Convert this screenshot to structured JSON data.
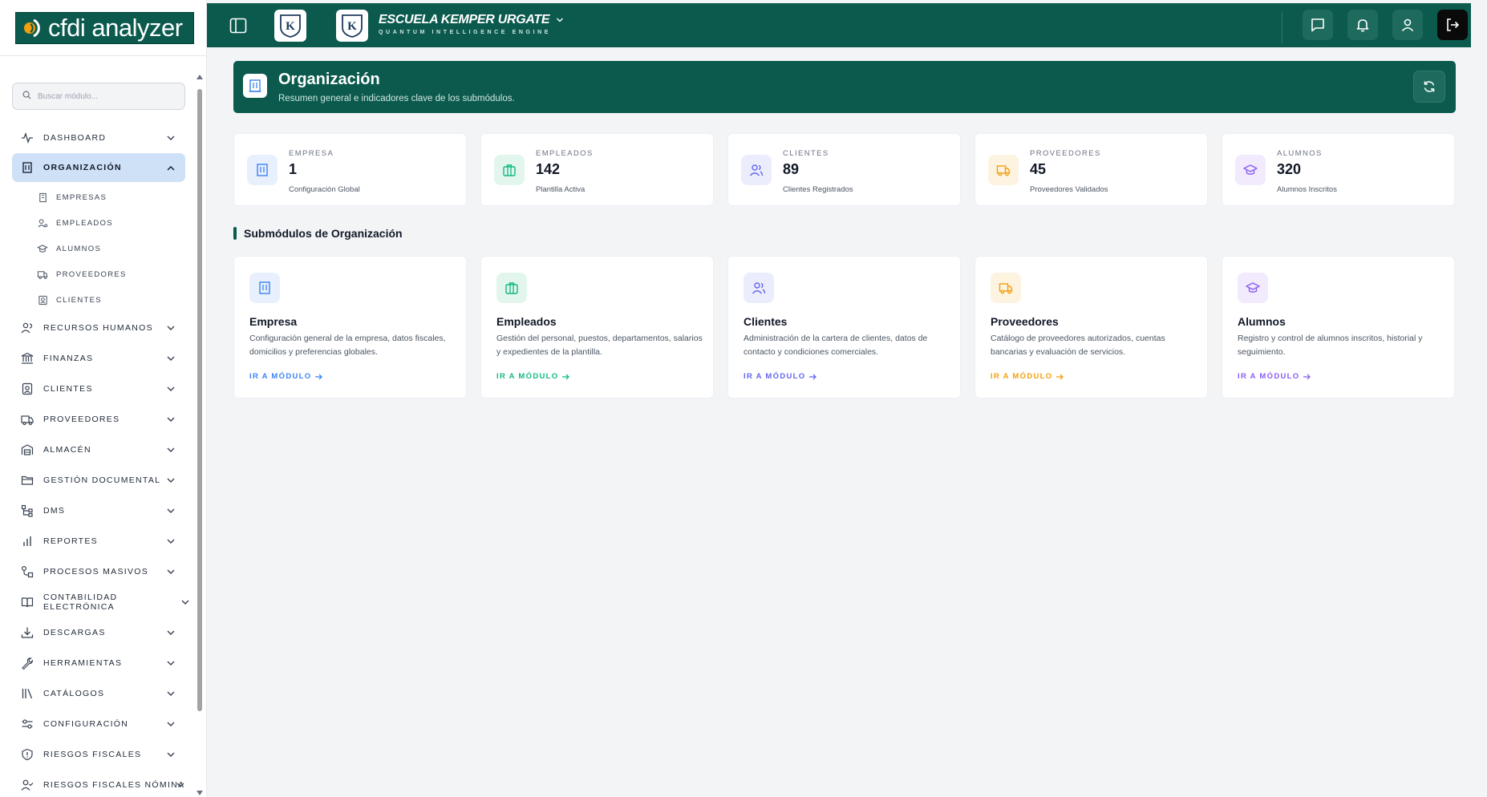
{
  "brand": {
    "name": "cfdi analyzer"
  },
  "search": {
    "placeholder": "Buscar módulo..."
  },
  "sidebar": {
    "items": [
      {
        "label": "DASHBOARD",
        "icon": "activity-icon"
      },
      {
        "label": "ORGANIZACIÓN",
        "icon": "building-icon",
        "active": true
      },
      {
        "label": "RECURSOS HUMANOS",
        "icon": "users-icon"
      },
      {
        "label": "FINANZAS",
        "icon": "bank-icon"
      },
      {
        "label": "CLIENTES",
        "icon": "contact-icon"
      },
      {
        "label": "PROVEEDORES",
        "icon": "truck-icon"
      },
      {
        "label": "ALMACÉN",
        "icon": "warehouse-icon"
      },
      {
        "label": "GESTIÓN DOCUMENTAL",
        "icon": "folder-icon"
      },
      {
        "label": "DMS",
        "icon": "tree-icon"
      },
      {
        "label": "REPORTES",
        "icon": "bar-chart-icon"
      },
      {
        "label": "PROCESOS MASIVOS",
        "icon": "workflow-icon"
      },
      {
        "label": "CONTABILIDAD ELECTRÓNICA",
        "icon": "book-icon"
      },
      {
        "label": "DESCARGAS",
        "icon": "download-icon"
      },
      {
        "label": "HERRAMIENTAS",
        "icon": "wrench-icon"
      },
      {
        "label": "CATÁLOGOS",
        "icon": "library-icon"
      },
      {
        "label": "CONFIGURACIÓN",
        "icon": "settings-icon"
      },
      {
        "label": "RIESGOS FISCALES",
        "icon": "alert-icon"
      },
      {
        "label": "RIESGOS FISCALES NÓMINA",
        "icon": "user-check-icon"
      }
    ],
    "sub_items": [
      {
        "label": "EMPRESAS",
        "icon": "building-icon"
      },
      {
        "label": "EMPLEADOS",
        "icon": "user-cog-icon"
      },
      {
        "label": "ALUMNOS",
        "icon": "graduation-cap-icon"
      },
      {
        "label": "PROVEEDORES",
        "icon": "truck-icon"
      },
      {
        "label": "CLIENTES",
        "icon": "contact-icon"
      }
    ]
  },
  "topbar": {
    "school_name": "ESCUELA KEMPER URGATE",
    "school_subtitle": "QUANTUM INTELLIGENCE ENGINE",
    "logo_letter": "K"
  },
  "header": {
    "title": "Organización",
    "subtitle": "Resumen general e indicadores clave de los submódulos."
  },
  "stats": [
    {
      "label": "EMPRESA",
      "value": "1",
      "desc": "Configuración Global",
      "color": "#3b82f6",
      "bg": "#e8f0fd"
    },
    {
      "label": "EMPLEADOS",
      "value": "142",
      "desc": "Plantilla Activa",
      "color": "#10b981",
      "bg": "#e3f6ee"
    },
    {
      "label": "CLIENTES",
      "value": "89",
      "desc": "Clientes Registrados",
      "color": "#6366f1",
      "bg": "#ecedfc"
    },
    {
      "label": "PROVEEDORES",
      "value": "45",
      "desc": "Proveedores Validados",
      "color": "#f59e0b",
      "bg": "#fdf3e1"
    },
    {
      "label": "ALUMNOS",
      "value": "320",
      "desc": "Alumnos Inscritos",
      "color": "#8b5cf6",
      "bg": "#f1ebfd"
    }
  ],
  "section": {
    "title": "Submódulos de Organización"
  },
  "cards": [
    {
      "title": "Empresa",
      "desc": "Configuración general de la empresa, datos fiscales, domicilios y preferencias globales.",
      "link": "IR A MÓDULO",
      "color": "#3b82f6",
      "bg": "#e8f0fd"
    },
    {
      "title": "Empleados",
      "desc": "Gestión del personal, puestos, departamentos, salarios y expedientes de la plantilla.",
      "link": "IR A MÓDULO",
      "color": "#10b981",
      "bg": "#e3f6ee"
    },
    {
      "title": "Clientes",
      "desc": "Administración de la cartera de clientes, datos de contacto y condiciones comerciales.",
      "link": "IR A MÓDULO",
      "color": "#6366f1",
      "bg": "#ecedfc"
    },
    {
      "title": "Proveedores",
      "desc": "Catálogo de proveedores autorizados, cuentas bancarias y evaluación de servicios.",
      "link": "IR A MÓDULO",
      "color": "#f59e0b",
      "bg": "#fdf3e1"
    },
    {
      "title": "Alumnos",
      "desc": "Registro y control de alumnos inscritos, historial y seguimiento.",
      "link": "IR A MÓDULO",
      "color": "#8b5cf6",
      "bg": "#f1ebfd"
    }
  ]
}
